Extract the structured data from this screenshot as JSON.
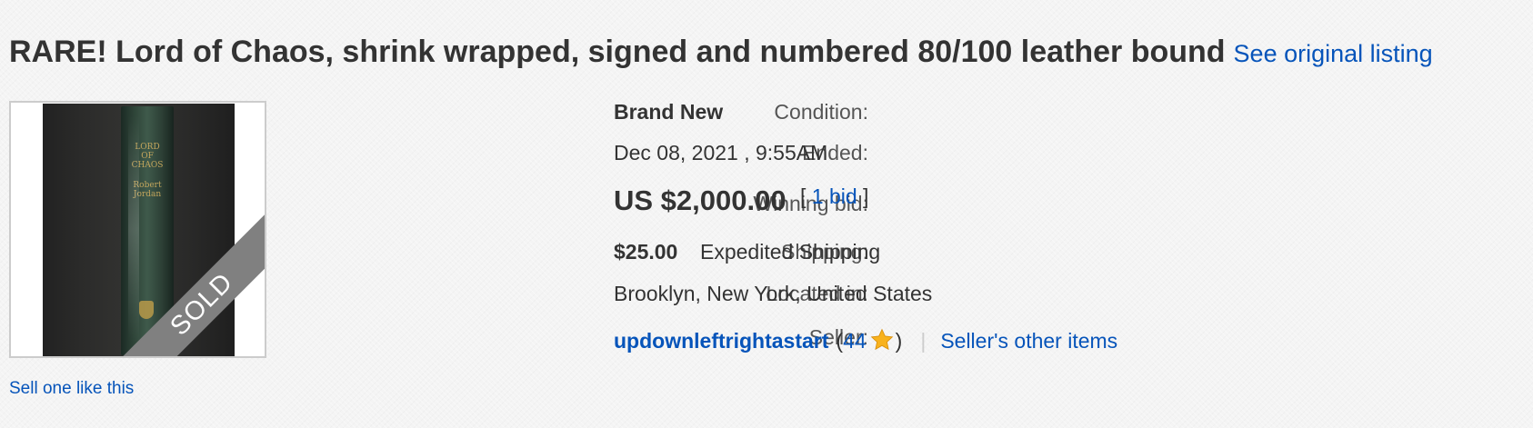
{
  "listing": {
    "title": "RARE! Lord of Chaos, shrink wrapped, signed and numbered 80/100 leather bound",
    "original_link": "See original listing"
  },
  "image": {
    "sold_label": "SOLD",
    "photo_subject": "book-spine"
  },
  "sell_one": "Sell one like this",
  "details": {
    "condition_label": "Condition:",
    "condition_value": "Brand New",
    "ended_label": "Ended:",
    "ended_value": "Dec 08, 2021 , 9:55AM",
    "winning_bid_label": "Winning bid:",
    "winning_bid_value": "US $2,000.00",
    "bid_open": "[ ",
    "bid_link": "1 bid",
    "bid_close": " ]",
    "shipping_label": "Shipping:",
    "shipping_cost": "$25.00",
    "shipping_method": "Expedited Shipping",
    "location_label": "Located in:",
    "location_value": "Brooklyn, New York, United States",
    "seller_label": "Seller:",
    "seller_name": "updownleftrightastart",
    "feedback_open": "(",
    "feedback_score": "44",
    "feedback_close": ")",
    "feedback_icon": "star-icon",
    "separator": "|",
    "other_items": "Seller's other items"
  },
  "colors": {
    "link": "#0654ba",
    "text": "#333333",
    "label": "#555555",
    "background": "#f4f4f4",
    "sold_ribbon": "#808080",
    "star": "#f8b21d"
  }
}
